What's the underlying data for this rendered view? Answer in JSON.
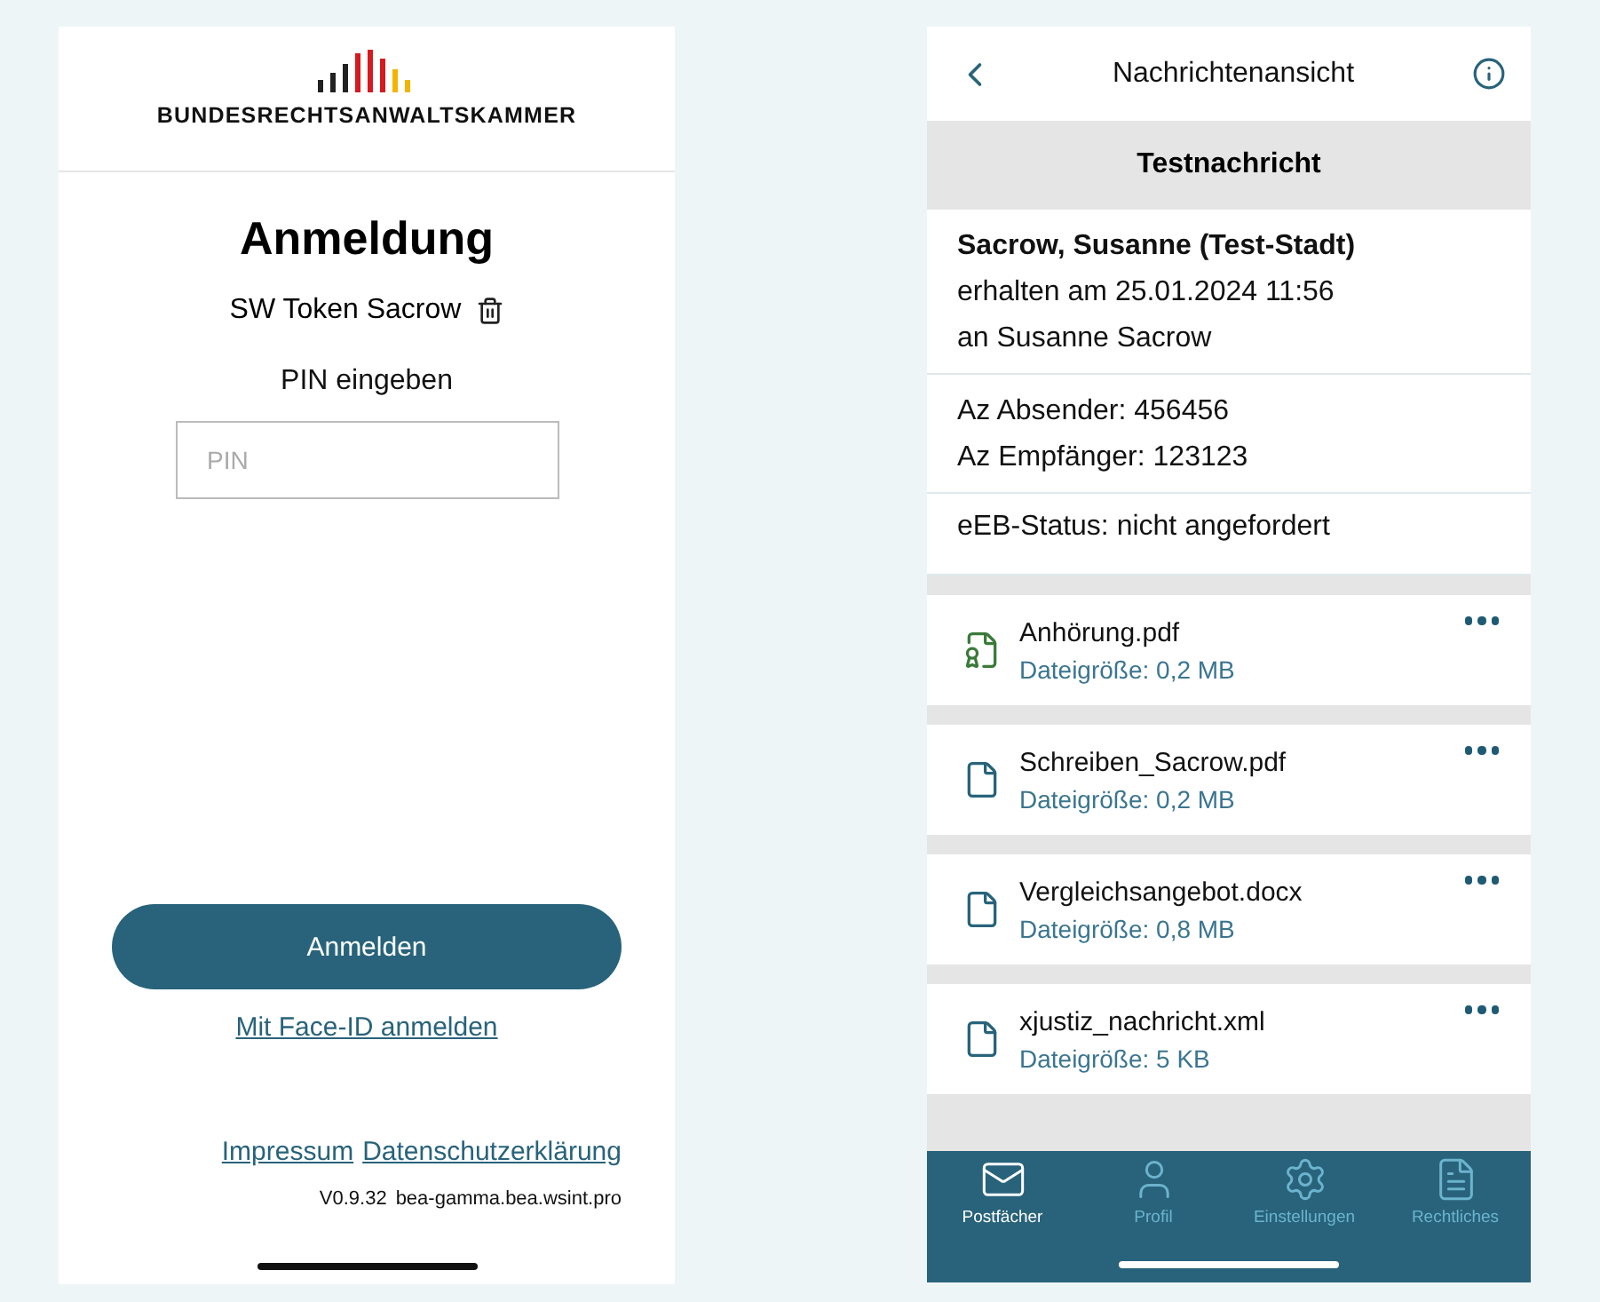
{
  "login": {
    "logo_text": "BUNDESRECHTSANWALTSKAMMER",
    "title": "Anmeldung",
    "token": "SW Token Sacrow",
    "pin_label": "PIN eingeben",
    "pin_field": {
      "placeholder": "PIN"
    },
    "submit": "Anmelden",
    "face_id_link": "Mit Face-ID anmelden",
    "footer_links": [
      "Impressum",
      "Datenschutzerklärung"
    ],
    "version": "V0.9.32",
    "host": "bea-gamma.bea.wsint.pro"
  },
  "message": {
    "title": "Nachrichtenansicht",
    "subject": "Testnachricht",
    "sender": "Sacrow, Susanne (Test-Stadt)",
    "received": "erhalten am 25.01.2024 11:56",
    "recipient": "an Susanne Sacrow",
    "references": [
      "Az Absender: 456456",
      "Az Empfänger: 123123"
    ],
    "eeb_status": "eEB-Status: nicht angefordert",
    "attachments": [
      {
        "kind": "certified",
        "name": "Anhörung.pdf",
        "size": "Dateigröße: 0,2 MB"
      },
      {
        "kind": "document",
        "name": "Schreiben_Sacrow.pdf",
        "size": "Dateigröße: 0,2 MB"
      },
      {
        "kind": "document",
        "name": "Vergleichsangebot.docx",
        "size": "Dateigröße: 0,8 MB"
      },
      {
        "kind": "document",
        "name": "xjustiz_nachricht.xml",
        "size": "Dateigröße: 5 KB"
      }
    ]
  },
  "tab_bar": [
    {
      "kind": "mail",
      "label": "Postfächer",
      "selected": true
    },
    {
      "kind": "profile",
      "label": "Profil",
      "selected": false
    },
    {
      "kind": "settings",
      "label": "Einstellungen",
      "selected": false
    },
    {
      "kind": "legal",
      "label": "Rechtliches",
      "selected": false
    }
  ]
}
